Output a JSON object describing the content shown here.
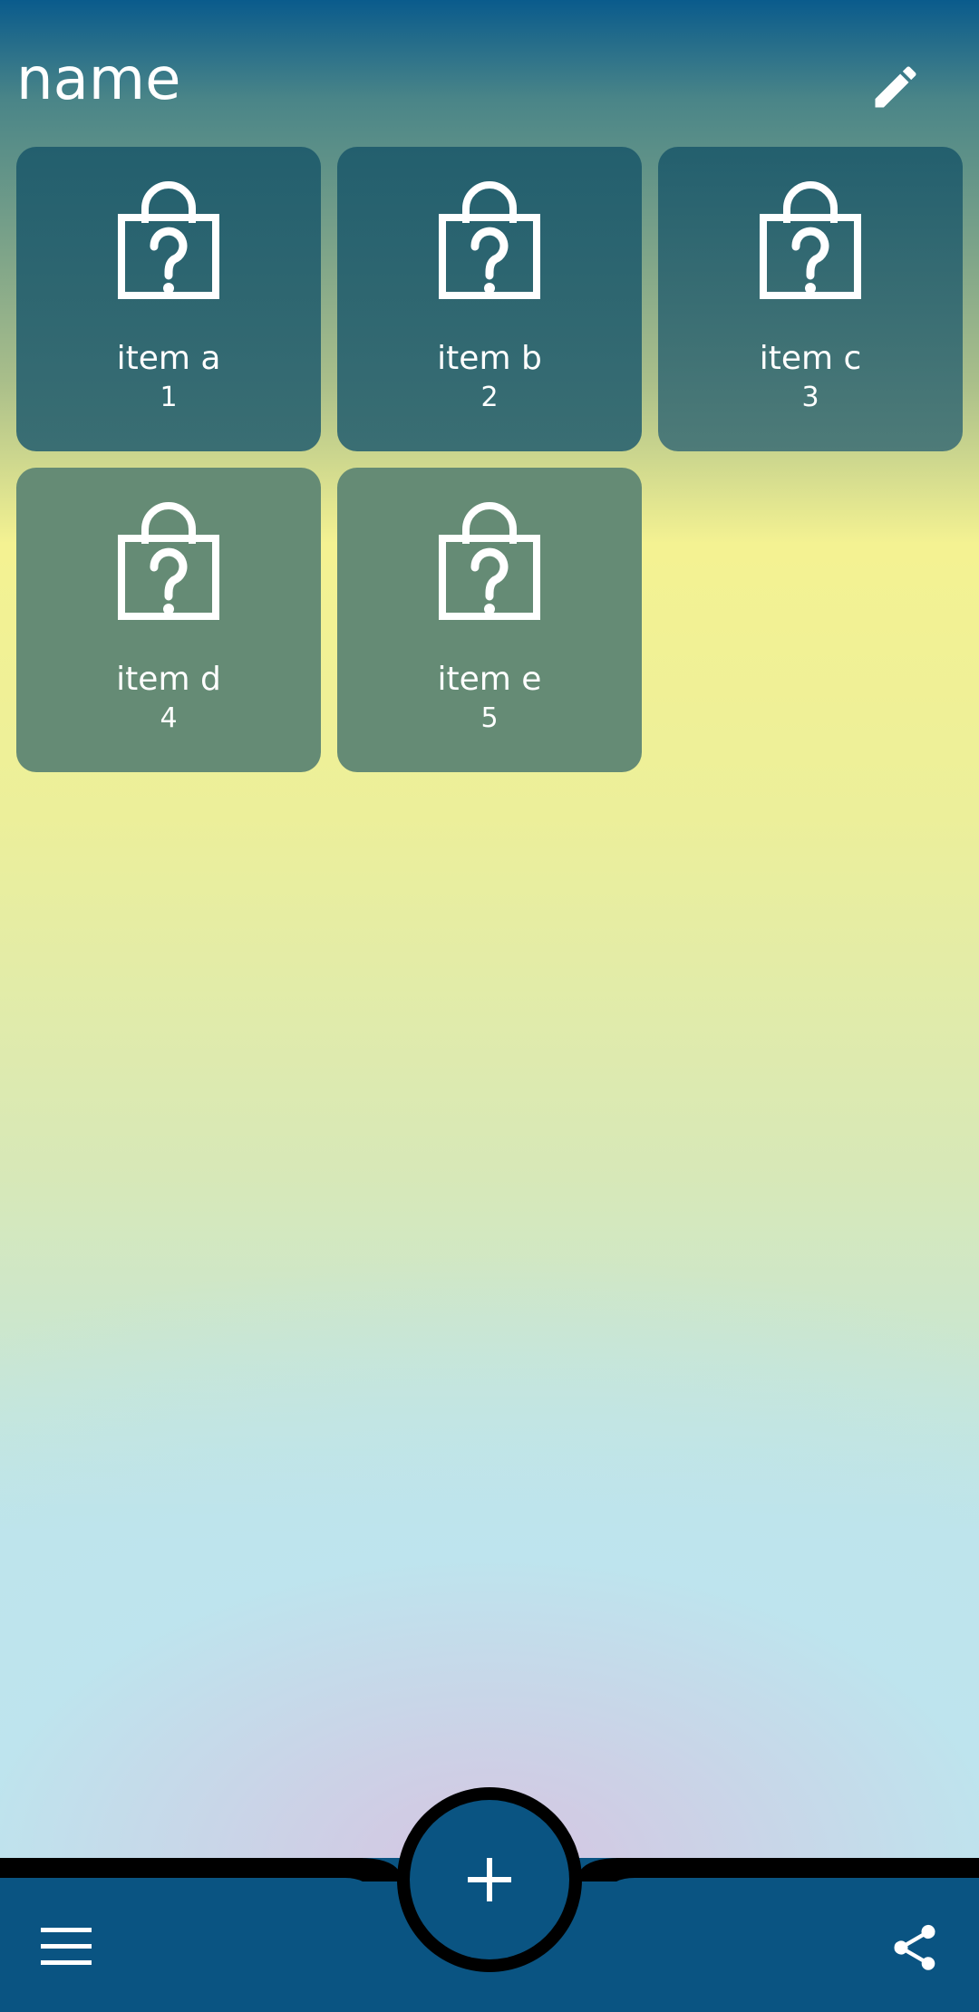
{
  "header": {
    "title": "name",
    "edit_icon": "pencil-icon"
  },
  "colors": {
    "primary": "#0a5482",
    "tile_top_row": "#2e6470",
    "tile_bottom_row": "#648b74",
    "text": "#ffffff"
  },
  "items": [
    {
      "name": "item a",
      "count": "1",
      "icon": "shopping-bag-question-icon"
    },
    {
      "name": "item b",
      "count": "2",
      "icon": "shopping-bag-question-icon"
    },
    {
      "name": "item c",
      "count": "3",
      "icon": "shopping-bag-question-icon"
    },
    {
      "name": "item d",
      "count": "4",
      "icon": "shopping-bag-question-icon"
    },
    {
      "name": "item e",
      "count": "5",
      "icon": "shopping-bag-question-icon"
    }
  ],
  "bottom_bar": {
    "menu_icon": "menu-icon",
    "add_icon": "plus-icon",
    "share_icon": "share-icon"
  }
}
